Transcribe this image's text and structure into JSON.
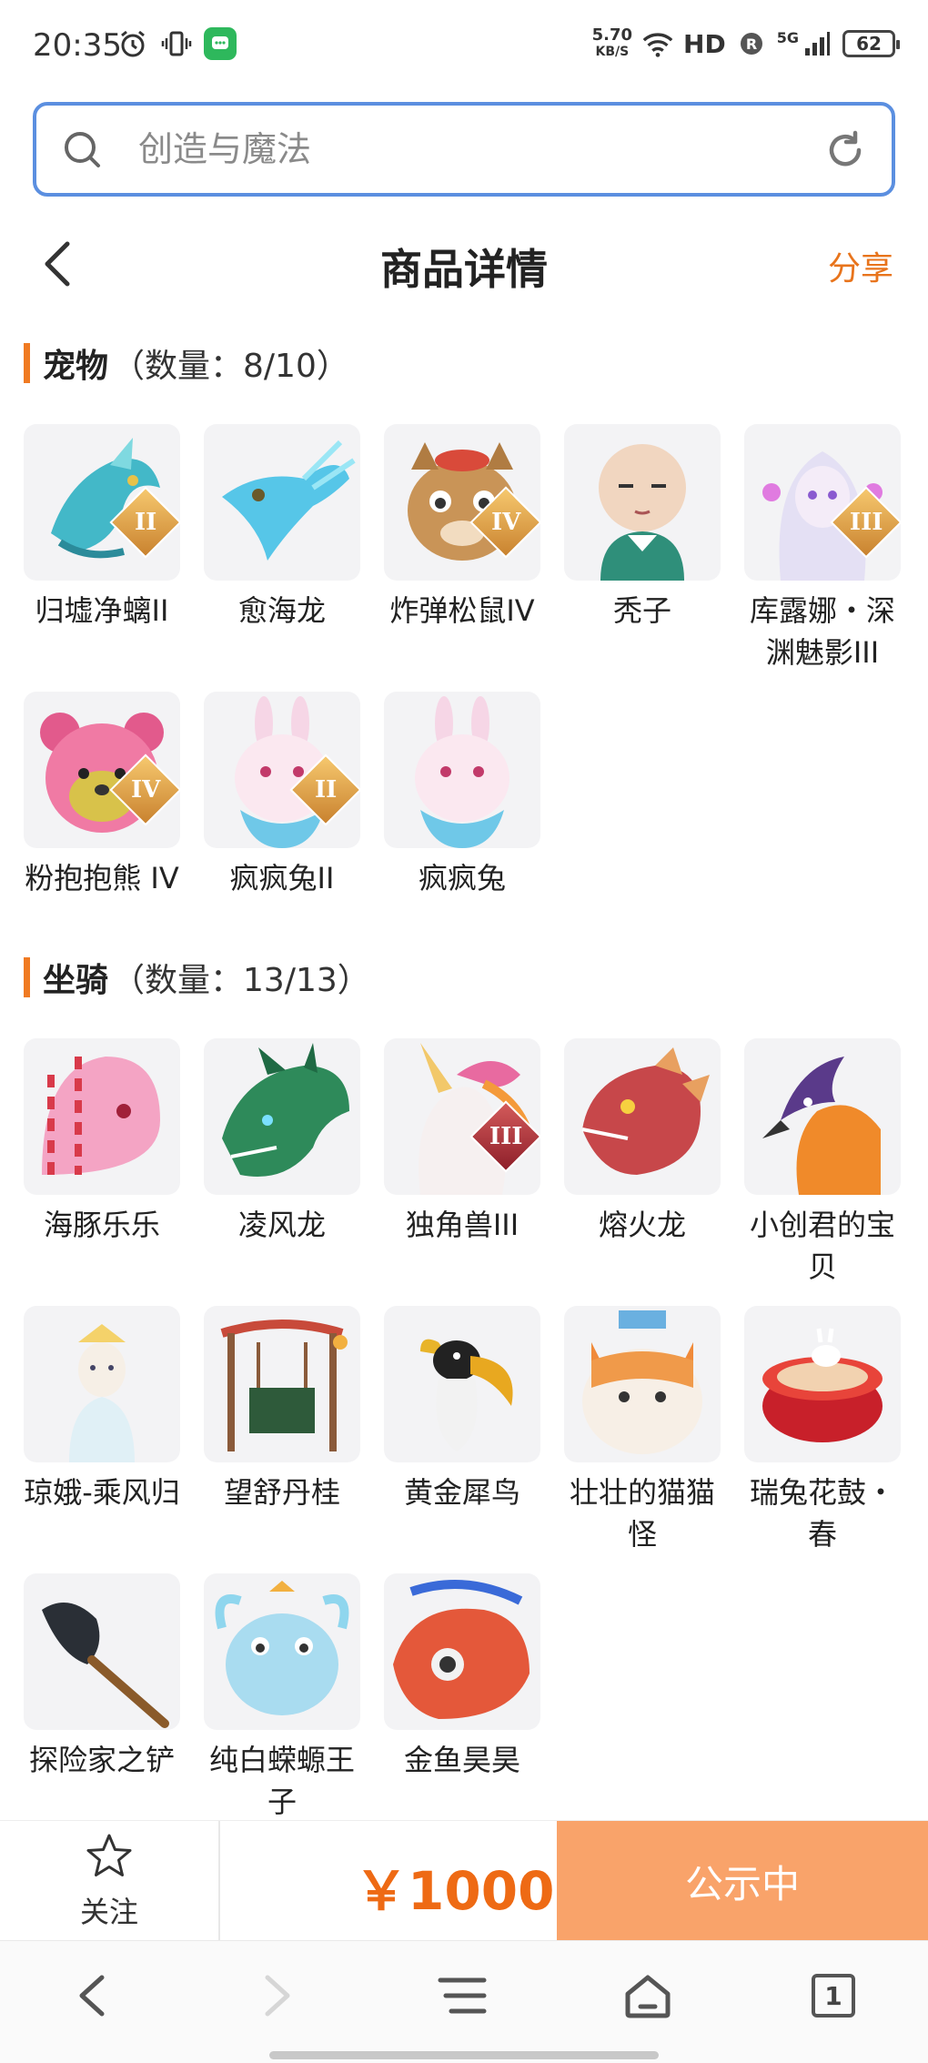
{
  "status_bar": {
    "time": "20:35",
    "net_speed_value": "5.70",
    "net_speed_unit": "KB/S",
    "hd_label": "HD",
    "signal_label": "5G",
    "battery": "62"
  },
  "search": {
    "placeholder": "创造与魔法",
    "value": ""
  },
  "header": {
    "title": "商品详情",
    "share_label": "分享"
  },
  "pets": {
    "title": "宠物",
    "count": "（数量：8/10）",
    "items": [
      {
        "name": "归墟净螭II",
        "rank": "II"
      },
      {
        "name": "愈海龙",
        "rank": ""
      },
      {
        "name": "炸弹松鼠IV",
        "rank": "IV"
      },
      {
        "name": "秃子",
        "rank": ""
      },
      {
        "name": "库露娜・深渊魅影III",
        "rank": "III"
      },
      {
        "name": "粉抱抱熊 IV",
        "rank": "IV"
      },
      {
        "name": "疯疯兔II",
        "rank": "II"
      },
      {
        "name": "疯疯兔",
        "rank": ""
      }
    ]
  },
  "mounts": {
    "title": "坐骑",
    "count": "（数量：13/13）",
    "items": [
      {
        "name": "海豚乐乐",
        "rank": ""
      },
      {
        "name": "凌风龙",
        "rank": ""
      },
      {
        "name": "独角兽III",
        "rank": "III"
      },
      {
        "name": "熔火龙",
        "rank": ""
      },
      {
        "name": "小创君的宝贝",
        "rank": ""
      },
      {
        "name": "琼娥-乘风归",
        "rank": ""
      },
      {
        "name": "望舒丹桂",
        "rank": ""
      },
      {
        "name": "黄金犀鸟",
        "rank": ""
      },
      {
        "name": "壮壮的猫猫怪",
        "rank": ""
      },
      {
        "name": "瑞兔花鼓・春",
        "rank": ""
      },
      {
        "name": "探险家之铲",
        "rank": ""
      },
      {
        "name": "纯白蝾螈王子",
        "rank": ""
      },
      {
        "name": "金鱼昊昊",
        "rank": ""
      }
    ]
  },
  "action_bar": {
    "follow_label": "关注",
    "price": "￥1000",
    "status_label": "公示中"
  },
  "nav": {
    "tab_count": "1"
  },
  "colors": {
    "accent": "#ee6a14",
    "search_border": "#5b8fe0",
    "status_button": "#f9a36a"
  }
}
